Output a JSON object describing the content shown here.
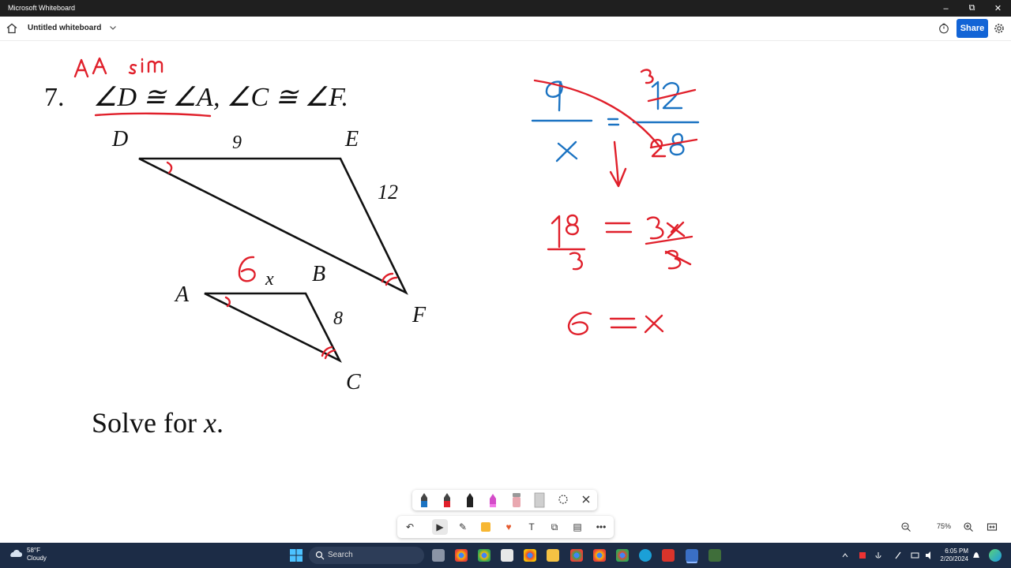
{
  "window": {
    "title": "Microsoft Whiteboard",
    "controls": [
      "–",
      "⧉",
      "✕"
    ]
  },
  "appbar": {
    "board_name": "Untitled whiteboard",
    "share_label": "Share"
  },
  "problem": {
    "number": "7.",
    "statement_parts": [
      "∠D ≅ ∠A",
      ", ∠C ≅ ∠F."
    ],
    "large_triangle": {
      "vertices": [
        "D",
        "E",
        "F"
      ],
      "side_DE": "9",
      "side_EF": "12"
    },
    "small_triangle": {
      "vertices": [
        "A",
        "B",
        "C"
      ],
      "side_AB": "x",
      "side_BC": "8"
    },
    "instruction_prefix": "Solve for ",
    "instruction_var": "x",
    "instruction_suffix": "."
  },
  "pen_colors": {
    "red": "#e0202b",
    "blue": "#1b73c2"
  },
  "zoom": {
    "value": "75%"
  },
  "taskbar": {
    "temperature": "58°F",
    "condition": "Cloudy",
    "search_label": "Search",
    "time": "6:05 PM",
    "date": "2/20/2024"
  }
}
